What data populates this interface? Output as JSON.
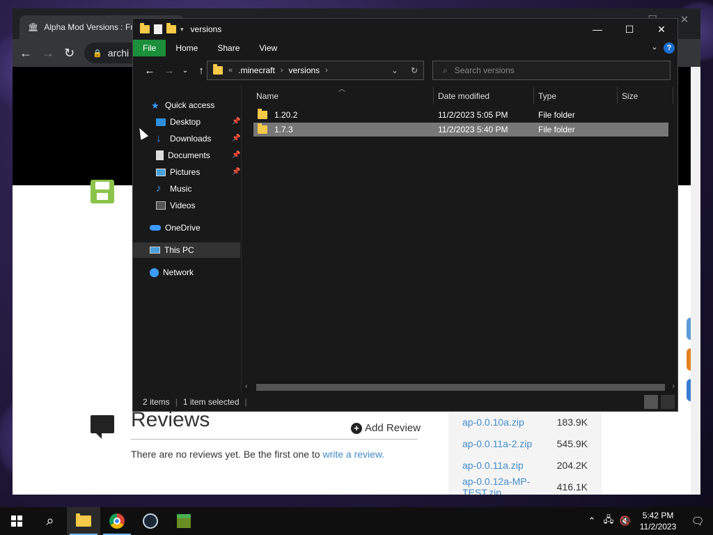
{
  "chrome": {
    "tab_title": "Alpha Mod Versions : Fr",
    "omnibox_text": "archi",
    "reviews_title": "Reviews",
    "add_review": "Add Review",
    "no_reviews_text": "There are no reviews yet. Be the first one to ",
    "write_review_link": "write a review.",
    "files": [
      {
        "name": "ap-0.0.10a.zip",
        "size": "183.9K"
      },
      {
        "name": "ap-0.0.11a-2.zip",
        "size": "545.9K"
      },
      {
        "name": "ap-0.0.11a.zip",
        "size": "204.2K"
      },
      {
        "name": "ap-0.0.12a-MP-TEST.zip",
        "size": "416.1K"
      }
    ]
  },
  "explorer": {
    "title": "versions",
    "ribbon": {
      "file": "File",
      "home": "Home",
      "share": "Share",
      "view": "View",
      "help": "?"
    },
    "address": {
      "overflow": "«",
      "crumb1": ".minecraft",
      "crumb2": "versions"
    },
    "search_placeholder": "Search versions",
    "nav": {
      "quick_access": "Quick access",
      "desktop": "Desktop",
      "downloads": "Downloads",
      "documents": "Documents",
      "pictures": "Pictures",
      "music": "Music",
      "videos": "Videos",
      "onedrive": "OneDrive",
      "this_pc": "This PC",
      "network": "Network"
    },
    "columns": {
      "name": "Name",
      "date": "Date modified",
      "type": "Type",
      "size": "Size"
    },
    "rows": [
      {
        "name": "1.20.2",
        "date": "11/2/2023 5:05 PM",
        "type": "File folder"
      },
      {
        "name": "1.7.3",
        "date": "11/2/2023 5:40 PM",
        "type": "File folder"
      }
    ],
    "status": {
      "items": "2 items",
      "selected": "1 item selected"
    }
  },
  "taskbar": {
    "time": "5:42 PM",
    "date": "11/2/2023"
  }
}
